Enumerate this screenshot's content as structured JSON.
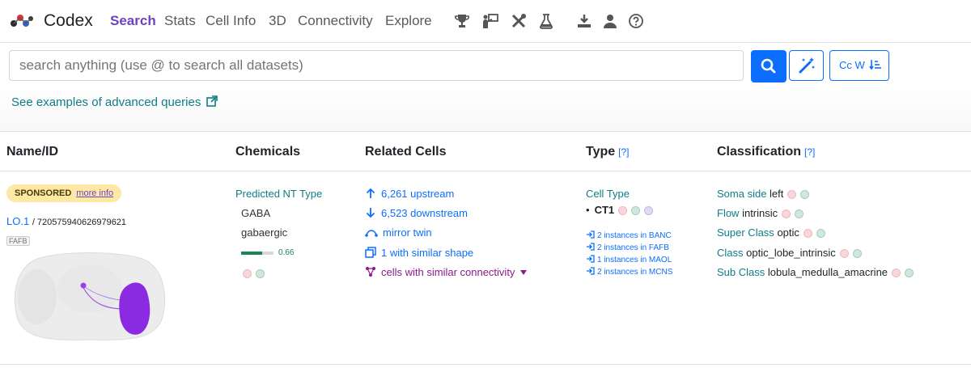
{
  "app": {
    "name": "Codex"
  },
  "nav": {
    "links": [
      "Search",
      "Stats",
      "Cell Info",
      "3D",
      "Connectivity",
      "Explore"
    ],
    "icons": [
      "trophy-icon",
      "person-chalkboard-icon",
      "tools-icon",
      "flask-icon",
      "download-icon",
      "user-icon",
      "help-circle-icon"
    ]
  },
  "search": {
    "placeholder": "search anything (use @ to search all datasets)",
    "case_button_label": "Cc W"
  },
  "examples_link": "See examples of advanced queries",
  "table": {
    "headers": {
      "name": "Name/ID",
      "chemicals": "Chemicals",
      "related": "Related Cells",
      "type": "Type",
      "classification": "Classification",
      "help": "[?]"
    },
    "row": {
      "sponsored": "SPONSORED",
      "more_info": "more info",
      "name": "LO.1",
      "id": "/ 720575940626979621",
      "dataset": "FAFB",
      "chem_label": "Predicted NT Type",
      "nt_values": [
        "GABA",
        "gabaergic"
      ],
      "nt_confidence": 0.66,
      "nt_confidence_label": "0.66",
      "related": {
        "upstream": "6,261 upstream",
        "downstream": "6,523 downstream",
        "mirror": "mirror twin",
        "similar_shape": "1 with similar shape",
        "similar_connectivity": "cells with similar connectivity"
      },
      "type_label": "Cell Type",
      "cell_type": "CT1",
      "instances": [
        "2 instances in BANC",
        "2 instances in FAFB",
        "1 instances in MAOL",
        "2 instances in MCNS"
      ],
      "classification": [
        {
          "key": "Soma side",
          "value": "left"
        },
        {
          "key": "Flow",
          "value": "intrinsic"
        },
        {
          "key": "Super Class",
          "value": "optic"
        },
        {
          "key": "Class",
          "value": "optic_lobe_intrinsic"
        },
        {
          "key": "Sub Class",
          "value": "lobula_medulla_amacrine"
        }
      ]
    }
  },
  "colors": {
    "accent": "#6f42c1",
    "primary": "#0d6efd",
    "teal": "#0f7d8a",
    "sponsored_bg": "#fde8a6"
  }
}
